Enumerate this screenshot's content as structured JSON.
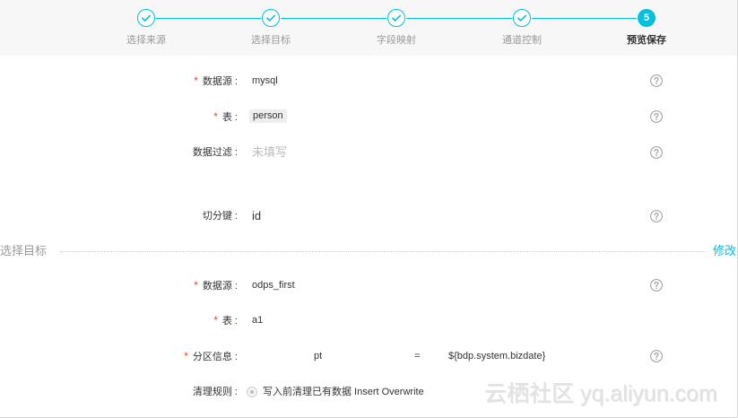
{
  "steps": [
    {
      "label": "选择来源",
      "icon": "check-icon",
      "done": true
    },
    {
      "label": "选择目标",
      "icon": "check-icon",
      "done": true
    },
    {
      "label": "字段映射",
      "icon": "check-icon",
      "done": true
    },
    {
      "label": "通道控制",
      "icon": "check-icon",
      "done": true
    },
    {
      "label": "预览保存",
      "number": "5",
      "current": true
    }
  ],
  "required_mark": "*",
  "source": {
    "datasource": {
      "label": "数据源 :",
      "value": "mysql"
    },
    "table": {
      "label": "表 :",
      "value": "person"
    },
    "filter": {
      "label": "数据过滤 :",
      "placeholder": "未填写"
    },
    "split_key": {
      "label": "切分键 :",
      "value": "id"
    }
  },
  "divider": {
    "title": "选择目标",
    "edit_label": "修改"
  },
  "target": {
    "datasource": {
      "label": "数据源 :",
      "value": "odps_first"
    },
    "table": {
      "label": "表 :",
      "value": "a1"
    },
    "partition": {
      "label": "分区信息 :",
      "key": "pt",
      "operator": "=",
      "value": "${bdp.system.bizdate}"
    },
    "clean_rule": {
      "label": "清理规则 :",
      "option_label": "写入前清理已有数据 Insert Overwrite",
      "checked": true
    }
  },
  "watermark": "云栖社区 yq.aliyun.com",
  "icons": {
    "help": "question-circle-icon",
    "step_done": "check-circle-icon",
    "radio": "radio-icon"
  },
  "colors": {
    "accent": "#00c1de",
    "required": "#f04134",
    "muted": "#999999",
    "placeholder": "#bbbbbb",
    "band": "#f7f7f7"
  }
}
